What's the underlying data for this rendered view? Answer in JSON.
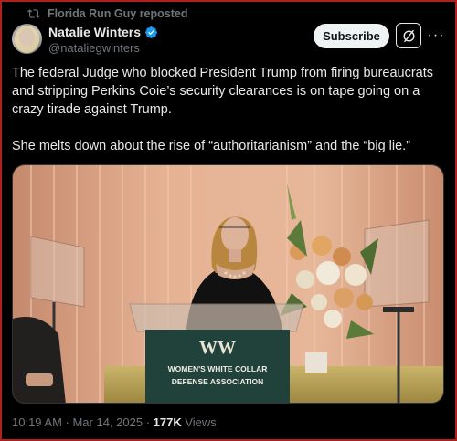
{
  "repost": {
    "label": "Florida Run Guy reposted",
    "icon": "repost-icon"
  },
  "author": {
    "name": "Natalie Winters",
    "handle": "@nataliegwinters",
    "verified_icon": "verified-badge-icon",
    "verified_color": "#1d9bf0"
  },
  "actions": {
    "subscribe_label": "Subscribe",
    "grok_icon": "grok-icon",
    "more_icon": "more-icon"
  },
  "post": {
    "paragraph1": "The federal Judge who blocked President Trump from firing bureaucrats and stripping Perkins Coie’s security clearances is on tape going on a crazy tirade against Trump.",
    "paragraph2": "She melts down about the rise of “authoritarianism” and the “big lie.”"
  },
  "media": {
    "podium_logo": "WW",
    "podium_line1": "WOMEN'S WHITE COLLAR",
    "podium_line2": "DEFENSE ASSOCIATION"
  },
  "meta": {
    "timestamp": "10:19 AM · Mar 14, 2025 · ",
    "views_count": "177K",
    "views_label": " Views"
  },
  "colors": {
    "background": "#000000",
    "text": "#e7e9ea",
    "muted": "#71767b",
    "accent": "#1d9bf0"
  }
}
